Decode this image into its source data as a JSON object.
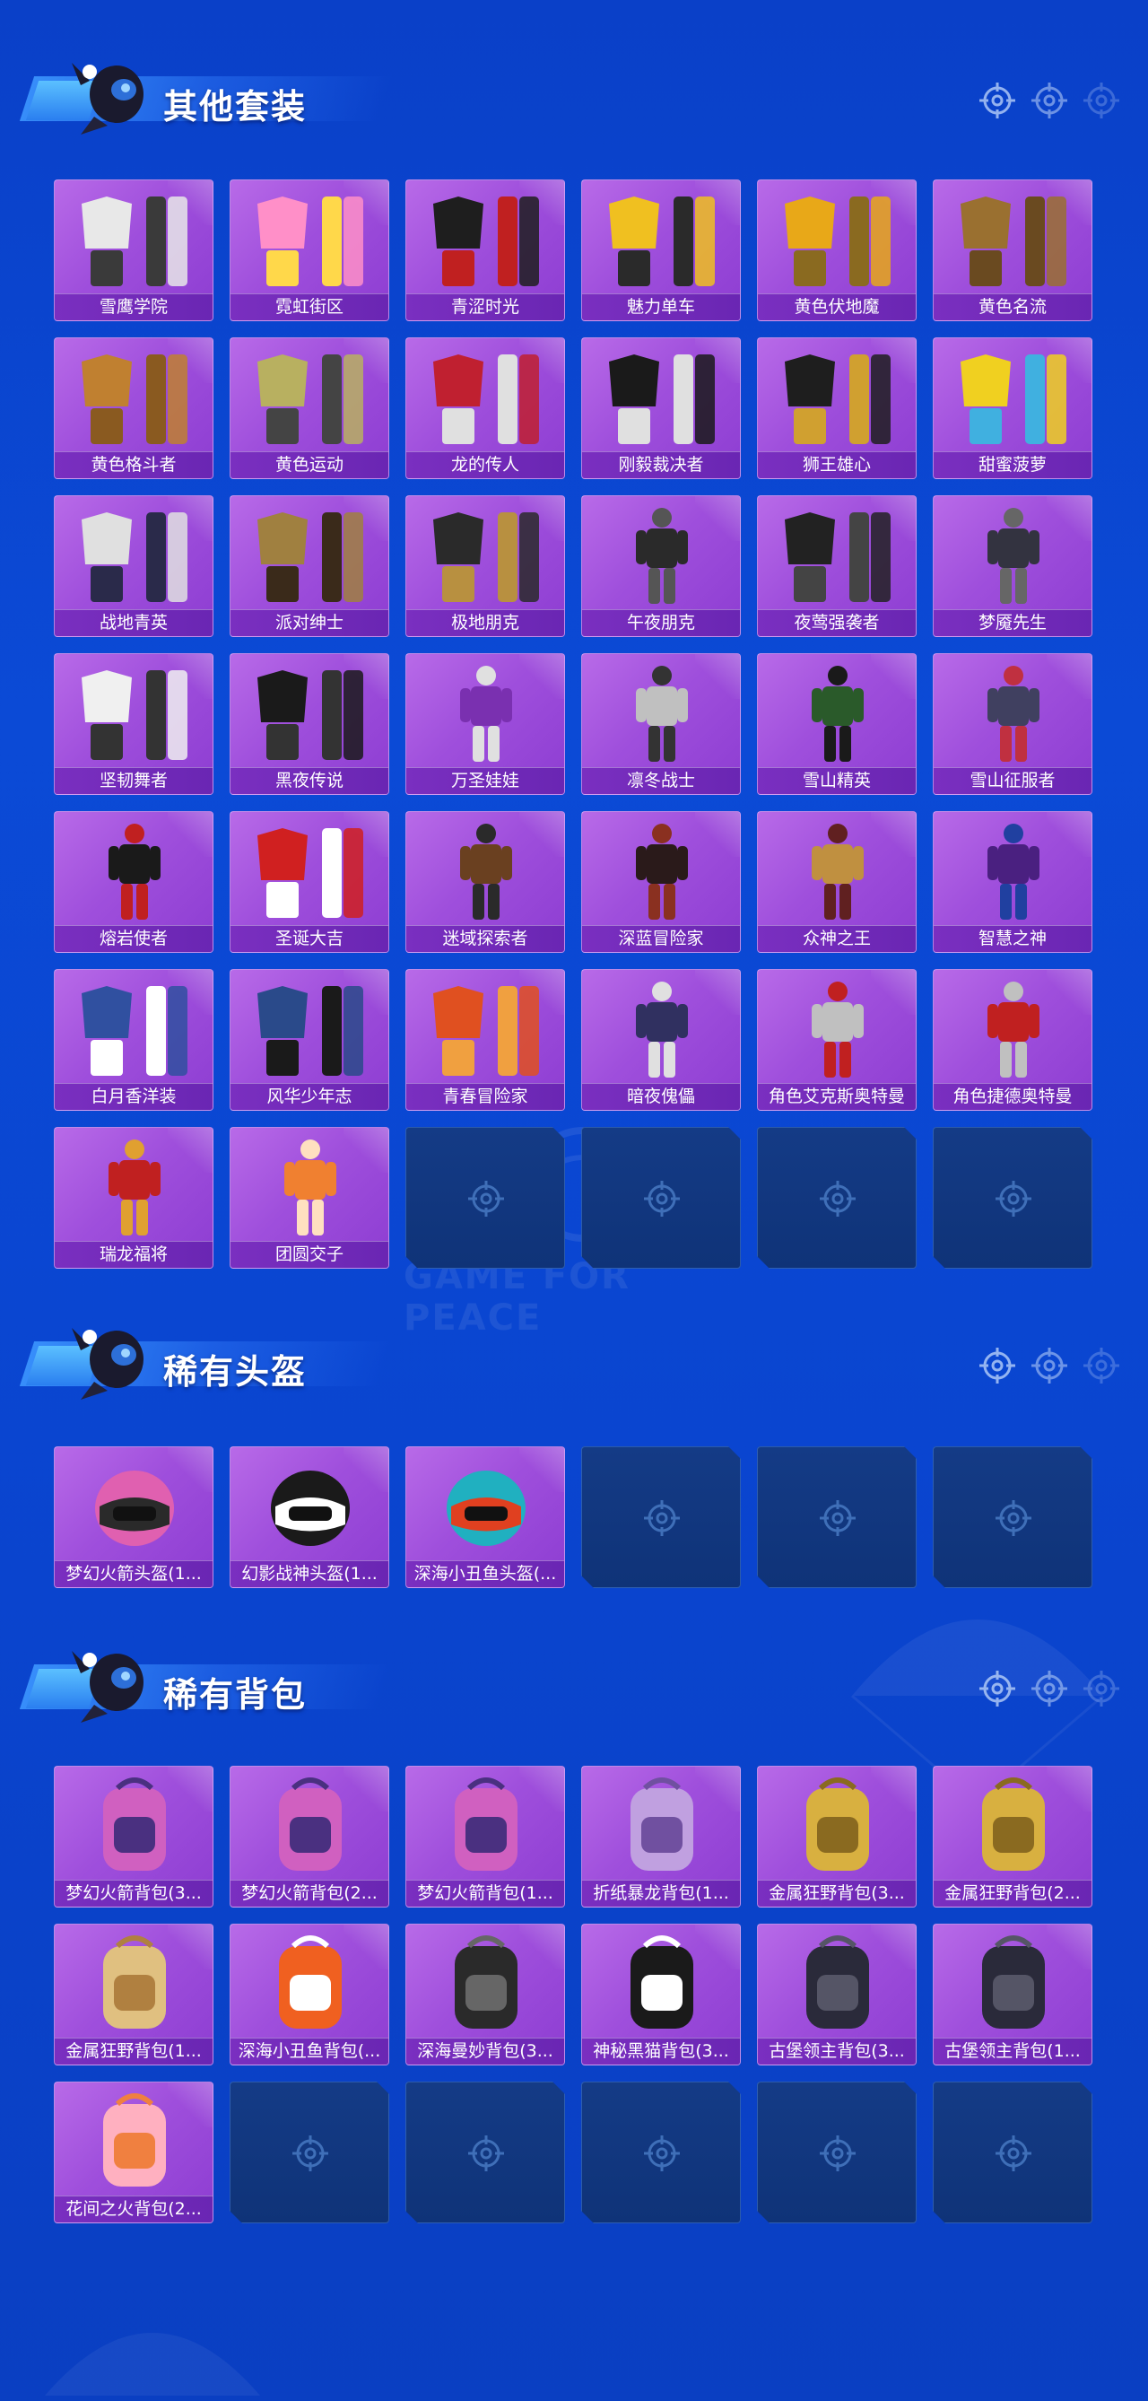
{
  "watermark_text": "GAME FOR PEACE",
  "sections": [
    {
      "title": "其他套装",
      "items": [
        {
          "name": "雪鹰学院",
          "art": "outfit-white"
        },
        {
          "name": "霓虹街区",
          "art": "outfit-pink"
        },
        {
          "name": "青涩时光",
          "art": "outfit-black-red"
        },
        {
          "name": "魅力单车",
          "art": "outfit-yellow"
        },
        {
          "name": "黄色伏地魔",
          "art": "outfit-yellow-hood"
        },
        {
          "name": "黄色名流",
          "art": "outfit-brown-suit"
        },
        {
          "name": "黄色格斗者",
          "art": "outfit-tan-jacket"
        },
        {
          "name": "黄色运动",
          "art": "outfit-olive"
        },
        {
          "name": "龙的传人",
          "art": "outfit-red"
        },
        {
          "name": "刚毅裁决者",
          "art": "outfit-black-white"
        },
        {
          "name": "狮王雄心",
          "art": "outfit-black-gold"
        },
        {
          "name": "甜蜜菠萝",
          "art": "outfit-yellow-blue"
        },
        {
          "name": "战地青英",
          "art": "outfit-striped"
        },
        {
          "name": "派对绅士",
          "art": "outfit-gold-suit"
        },
        {
          "name": "极地朋克",
          "art": "outfit-dark-gold"
        },
        {
          "name": "午夜朋克",
          "art": "figure-dark"
        },
        {
          "name": "夜莺强袭者",
          "art": "outfit-black-jacket"
        },
        {
          "name": "梦魇先生",
          "art": "figure-coat"
        },
        {
          "name": "坚韧舞者",
          "art": "outfit-white-dress"
        },
        {
          "name": "黑夜传说",
          "art": "outfit-black-duo"
        },
        {
          "name": "万圣娃娃",
          "art": "figure-purple"
        },
        {
          "name": "凛冬战士",
          "art": "figure-armor"
        },
        {
          "name": "雪山精英",
          "art": "figure-green"
        },
        {
          "name": "雪山征服者",
          "art": "figure-duo-red"
        },
        {
          "name": "熔岩使者",
          "art": "figure-black-red"
        },
        {
          "name": "圣诞大吉",
          "art": "outfit-christmas"
        },
        {
          "name": "迷域探索者",
          "art": "figure-brown-coat"
        },
        {
          "name": "深蓝冒险家",
          "art": "figure-dark-coat"
        },
        {
          "name": "众神之王",
          "art": "figure-gold-duo"
        },
        {
          "name": "智慧之神",
          "art": "figure-purple-duo"
        },
        {
          "name": "白月香洋装",
          "art": "outfit-blue-white"
        },
        {
          "name": "风华少年志",
          "art": "outfit-hanfu"
        },
        {
          "name": "青春冒险家",
          "art": "outfit-orange-red"
        },
        {
          "name": "暗夜傀儡",
          "art": "figure-doll"
        },
        {
          "name": "角色艾克斯奥特曼",
          "art": "figure-ultraman"
        },
        {
          "name": "角色捷德奥特曼",
          "art": "figure-ultraman-red"
        },
        {
          "name": "瑞龙福将",
          "art": "figure-dragon-red"
        },
        {
          "name": "团圆交子",
          "art": "figure-orange-duo"
        },
        {
          "name": "",
          "art": "empty"
        },
        {
          "name": "",
          "art": "empty"
        },
        {
          "name": "",
          "art": "empty"
        },
        {
          "name": "",
          "art": "empty"
        }
      ]
    },
    {
      "title": "稀有头盔",
      "items": [
        {
          "name": "梦幻火箭头盔(1...",
          "art": "helmet-pink"
        },
        {
          "name": "幻影战神头盔(1...",
          "art": "helmet-black"
        },
        {
          "name": "深海小丑鱼头盔(...",
          "art": "helmet-teal"
        },
        {
          "name": "",
          "art": "empty"
        },
        {
          "name": "",
          "art": "empty"
        },
        {
          "name": "",
          "art": "empty"
        }
      ]
    },
    {
      "title": "稀有背包",
      "items": [
        {
          "name": "梦幻火箭背包(3...",
          "art": "backpack-pink"
        },
        {
          "name": "梦幻火箭背包(2...",
          "art": "backpack-pink"
        },
        {
          "name": "梦幻火箭背包(1...",
          "art": "backpack-pink"
        },
        {
          "name": "折纸暴龙背包(1...",
          "art": "backpack-lavender"
        },
        {
          "name": "金属狂野背包(3...",
          "art": "backpack-gold"
        },
        {
          "name": "金属狂野背包(2...",
          "art": "backpack-gold"
        },
        {
          "name": "金属狂野背包(1...",
          "art": "backpack-gold-light"
        },
        {
          "name": "深海小丑鱼背包(...",
          "art": "backpack-orange"
        },
        {
          "name": "深海曼妙背包(3...",
          "art": "backpack-tanks"
        },
        {
          "name": "神秘黑猫背包(3...",
          "art": "backpack-cat"
        },
        {
          "name": "古堡领主背包(3...",
          "art": "backpack-dark"
        },
        {
          "name": "古堡领主背包(1...",
          "art": "backpack-dark"
        },
        {
          "name": "花间之火背包(2...",
          "art": "backpack-floral"
        },
        {
          "name": "",
          "art": "empty"
        },
        {
          "name": "",
          "art": "empty"
        },
        {
          "name": "",
          "art": "empty"
        },
        {
          "name": "",
          "art": "empty"
        },
        {
          "name": "",
          "art": "empty"
        }
      ]
    }
  ],
  "header_icons": [
    "target-icon",
    "target-icon",
    "target-icon"
  ],
  "colors": {
    "background": "#0b48d4",
    "card_purple": "#9f4fdc",
    "label_purple": "#7a2fc0",
    "empty_card": "#143b86"
  }
}
